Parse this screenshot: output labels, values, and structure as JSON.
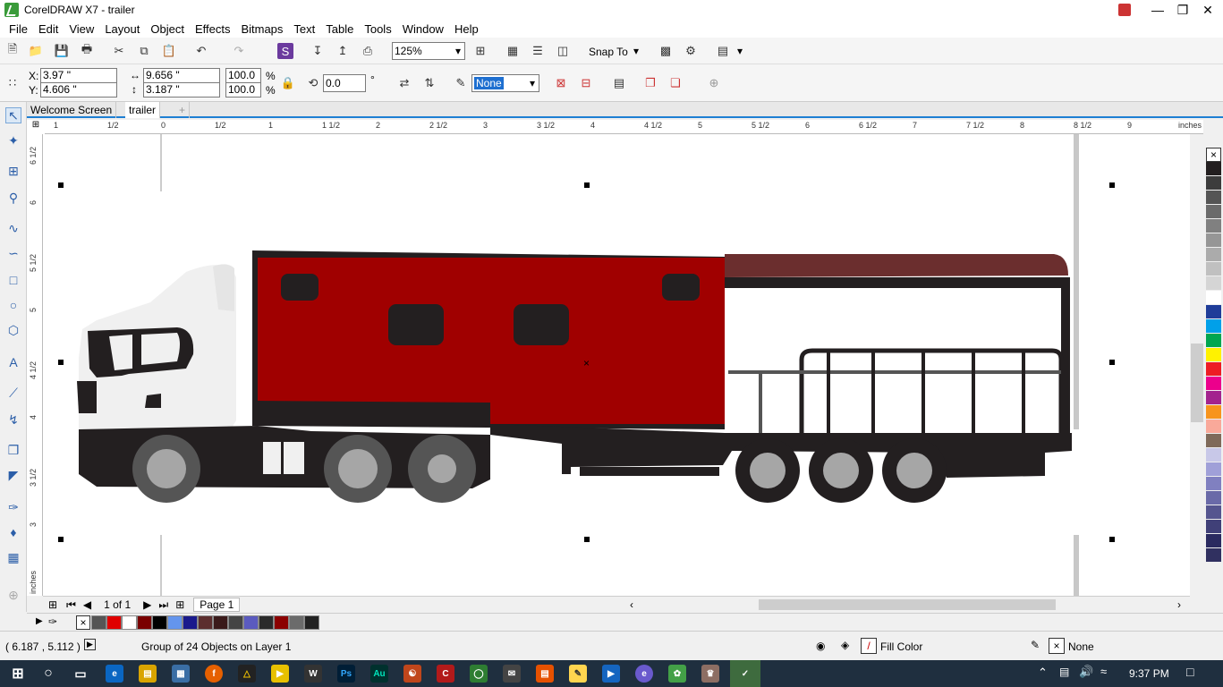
{
  "window": {
    "title": "CorelDRAW X7 - trailer"
  },
  "menu": [
    "File",
    "Edit",
    "View",
    "Layout",
    "Object",
    "Effects",
    "Bitmaps",
    "Text",
    "Table",
    "Tools",
    "Window",
    "Help"
  ],
  "toolbar": {
    "zoom": "125%",
    "snap_to": "Snap To"
  },
  "properties": {
    "x_label": "X:",
    "x_value": "3.97 \"",
    "y_label": "Y:",
    "y_value": "4.606 \"",
    "width_value": "9.656 \"",
    "height_value": "3.187 \"",
    "scale_w": "100.0",
    "scale_h": "100.0",
    "pct": "%",
    "rotation": "0.0",
    "deg": "°",
    "outline": "None"
  },
  "tabs": [
    "Welcome Screen",
    "trailer"
  ],
  "hruler": {
    "labels": [
      "1",
      "1/2",
      "0",
      "1/2",
      "1",
      "1 1/2",
      "2",
      "2 1/2",
      "3",
      "3 1/2",
      "4",
      "4 1/2",
      "5",
      "5 1/2",
      "6",
      "6 1/2",
      "7",
      "7 1/2",
      "8",
      "8 1/2",
      "9"
    ],
    "unit": "inches"
  },
  "vruler": {
    "labels": [
      "6 1/2",
      "6",
      "5 1/2",
      "5",
      "4 1/2",
      "4",
      "3 1/2",
      "3"
    ],
    "unit": "inches"
  },
  "pagenav": {
    "count": "1 of 1",
    "page": "Page 1"
  },
  "status": {
    "coords": "( 6.187 , 5.112 )",
    "message": "Group of 24 Objects on Layer 1",
    "fill": "Fill Color",
    "outline": "None"
  },
  "clock": {
    "time": "9:37 PM"
  },
  "colors": {
    "trailer_red": "#a00000",
    "roof_brown": "#6b2e2e",
    "truck_dark": "#231f20",
    "wheel_grey": "#a6a6a6",
    "cab_white": "#f0f0f0",
    "accent_blue": "#1e7fd3"
  },
  "palette": [
    "#ffffff",
    "#231f20",
    "#3c3c3c",
    "#555555",
    "#6b6b6b",
    "#808080",
    "#969696",
    "#ababab",
    "#c0c0c0",
    "#d5d5d5",
    "#ffffff",
    "#1f3d99",
    "#00a0e9",
    "#00a650",
    "#fff200",
    "#ed1c24",
    "#ec008c",
    "#a3238e",
    "#f7941d",
    "#f9a99a",
    "#7f6a5a",
    "#c8c8e8",
    "#a0a0d8",
    "#8080c0",
    "#6a6aa8",
    "#55558f",
    "#404078",
    "#2a2a60",
    "#303060"
  ],
  "doc_palette": [
    "#555555",
    "#e00000",
    "#ffffff",
    "#7a0000",
    "#000000",
    "#6495ed",
    "#1a1a8c",
    "#5c2e2e",
    "#3a1a1a",
    "#444444",
    "#5b5bbf",
    "#2a2a2a",
    "#8b0000",
    "#6b6b6b",
    "#222222"
  ]
}
